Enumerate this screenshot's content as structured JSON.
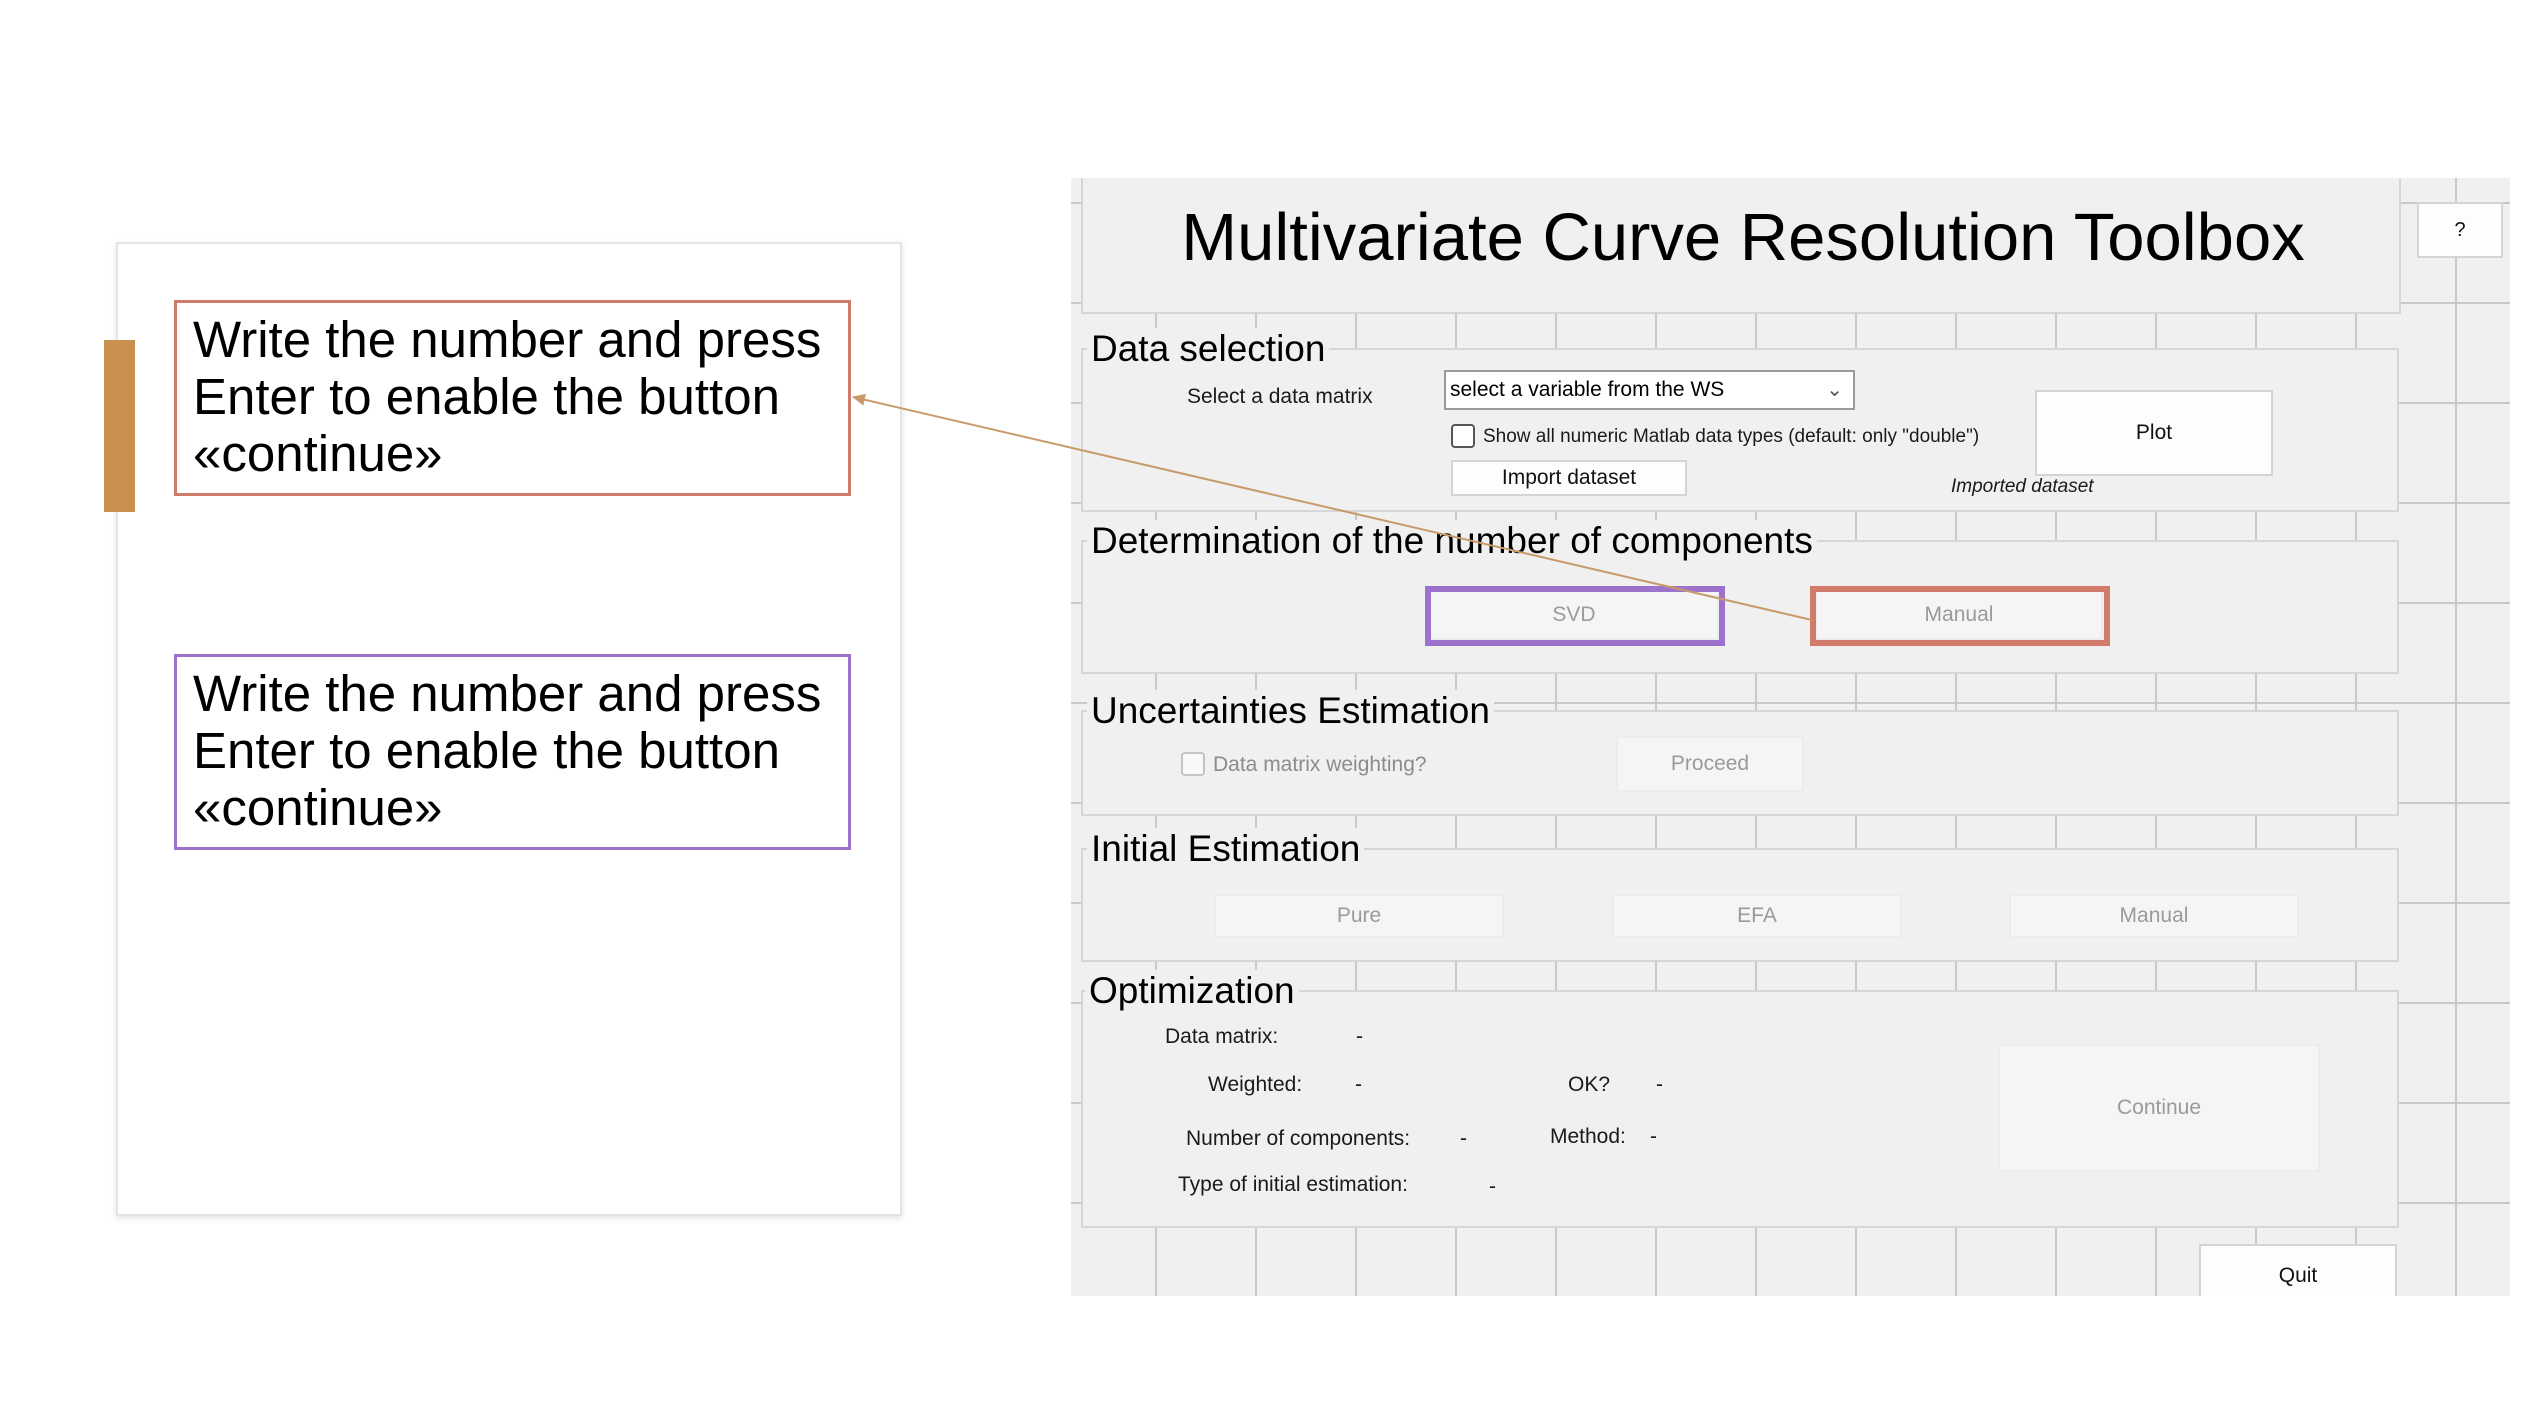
{
  "callouts": {
    "red_text": "Write the number and press Enter to enable the button «continue»",
    "purple_text": "Write the number and press Enter to enable the button «continue»"
  },
  "app": {
    "title": "Multivariate Curve Resolution Toolbox",
    "help_label": "?",
    "quit_label": "Quit"
  },
  "data_selection": {
    "title": "Data selection",
    "select_label": "Select a data matrix",
    "select_value": "select a variable from the WS",
    "show_all_label": "Show all numeric Matlab data types (default: only \"double\")",
    "import_label": "Import dataset",
    "plot_label": "Plot",
    "imported_label": "Imported dataset"
  },
  "components": {
    "title": "Determination of the number of components",
    "svd_label": "SVD",
    "manual_label": "Manual"
  },
  "uncertainties": {
    "title": "Uncertainties Estimation",
    "weighting_label": "Data matrix weighting?",
    "proceed_label": "Proceed"
  },
  "initial": {
    "title": "Initial Estimation",
    "pure_label": "Pure",
    "efa_label": "EFA",
    "manual_label": "Manual"
  },
  "optimization": {
    "title": "Optimization",
    "data_matrix_label": "Data matrix:",
    "data_matrix_value": "-",
    "weighted_label": "Weighted:",
    "weighted_value": "-",
    "ok_label": "OK?",
    "ok_value": "-",
    "ncomp_label": "Number of components:",
    "ncomp_value": "-",
    "method_label": "Method:",
    "method_value": "-",
    "init_type_label": "Type of initial estimation:",
    "init_type_value": "-",
    "continue_label": "Continue"
  },
  "colors": {
    "accent_bar": "#c8924e",
    "highlight_red": "#d07a6a",
    "highlight_purple": "#9c72cc",
    "arrow": "#c89a6a"
  }
}
